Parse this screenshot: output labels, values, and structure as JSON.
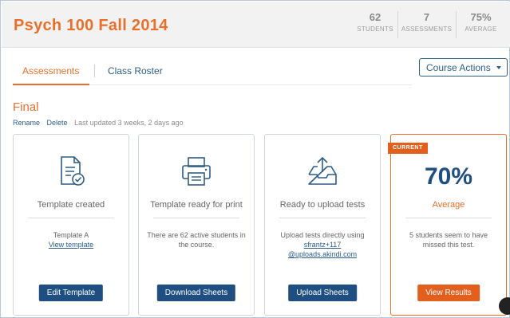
{
  "header": {
    "course_title": "Psych 100 Fall 2014",
    "stats": [
      {
        "value": "62",
        "label": "STUDENTS"
      },
      {
        "value": "7",
        "label": "ASSESSMENTS"
      },
      {
        "value": "75%",
        "label": "AVERAGE"
      }
    ]
  },
  "tabs": [
    {
      "label": "Assessments",
      "active": true
    },
    {
      "label": "Class Roster",
      "active": false
    }
  ],
  "course_actions": {
    "label": "Course Actions"
  },
  "assessment": {
    "title": "Final",
    "rename_label": "Rename",
    "delete_label": "Delete",
    "updated": "Last updated 3 weeks, 2 days ago"
  },
  "cards": [
    {
      "icon": "document-check-icon",
      "status": "Template created",
      "desc": "Template A",
      "link": "View template",
      "button": "Edit Template"
    },
    {
      "icon": "printer-icon",
      "status": "Template ready for print",
      "desc": "There are 62 active students in the course.",
      "button": "Download Sheets"
    },
    {
      "icon": "upload-tray-icon",
      "status": "Ready to upload tests",
      "desc": "Upload tests directly using",
      "link_lines": [
        "sfrantz+117",
        "@uploads.akindi.com"
      ],
      "button": "Upload Sheets"
    },
    {
      "ribbon": "CURRENT",
      "percent": "70%",
      "status": "Average",
      "desc": "5 students seem to have missed this test.",
      "button": "View Results"
    }
  ],
  "colors": {
    "accent_orange": "#e8702a",
    "primary_blue": "#1e4f80",
    "link_blue": "#2e5d86"
  }
}
